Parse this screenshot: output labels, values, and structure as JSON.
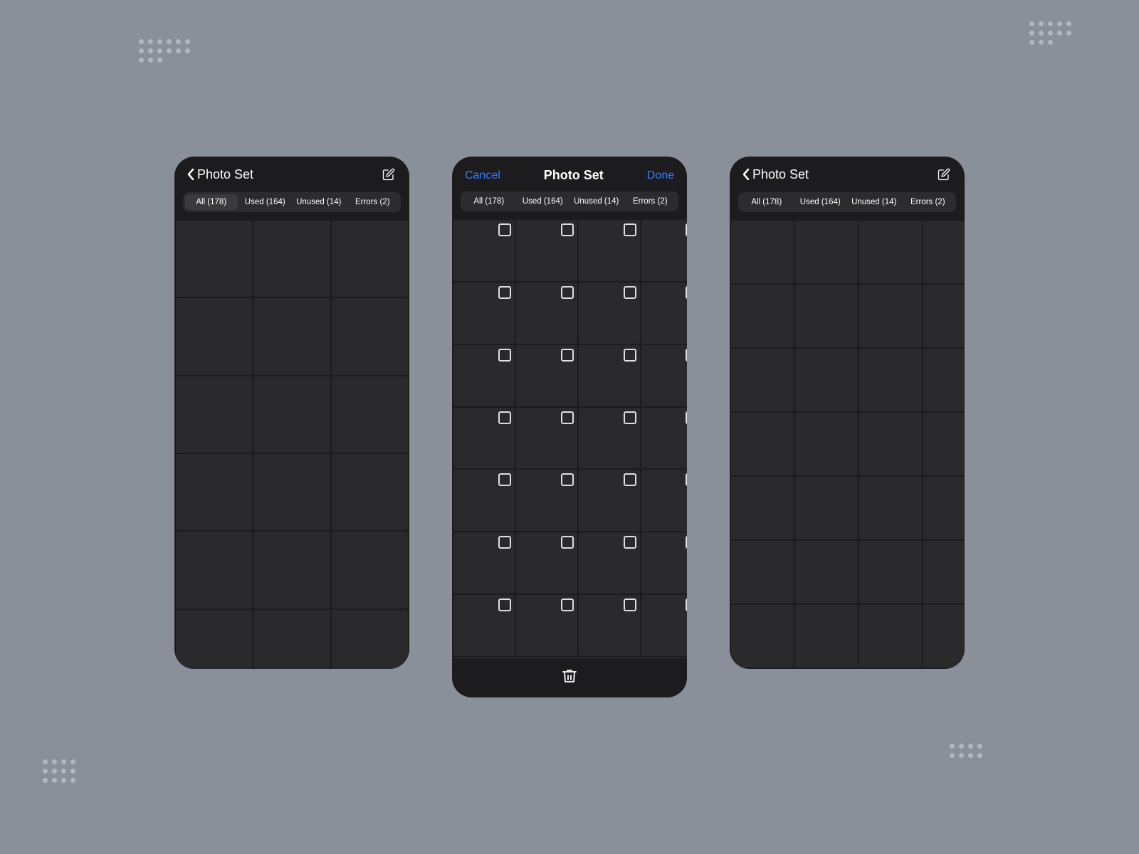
{
  "background_color": "#8a9099",
  "panels": {
    "left": {
      "title": "Photo Set",
      "tabs": [
        {
          "label": "All (178)",
          "active": true
        },
        {
          "label": "Used (164)",
          "active": false
        },
        {
          "label": "Unused (14)",
          "active": false
        },
        {
          "label": "Errors (2)",
          "active": false
        }
      ],
      "grid_cols": 3,
      "grid_rows": 8
    },
    "center": {
      "cancel_label": "Cancel",
      "title": "Photo Set",
      "done_label": "Done",
      "tabs": [
        {
          "label": "All (178)",
          "active": false
        },
        {
          "label": "Used (164)",
          "active": false
        },
        {
          "label": "Unused (14)",
          "active": false
        },
        {
          "label": "Errors (2)",
          "active": false
        }
      ],
      "grid_cols": 4,
      "grid_rows": 7
    },
    "right": {
      "title": "Photo Set",
      "tabs": [
        {
          "label": "All (178)",
          "active": false
        },
        {
          "label": "Used (164)",
          "active": false
        },
        {
          "label": "Unused (14)",
          "active": false
        },
        {
          "label": "Errors (2)",
          "active": false
        }
      ],
      "grid_cols": 4,
      "grid_rows": 7
    }
  },
  "icons": {
    "back": "‹",
    "edit": "edit-pencil",
    "trash": "trash-bin"
  }
}
